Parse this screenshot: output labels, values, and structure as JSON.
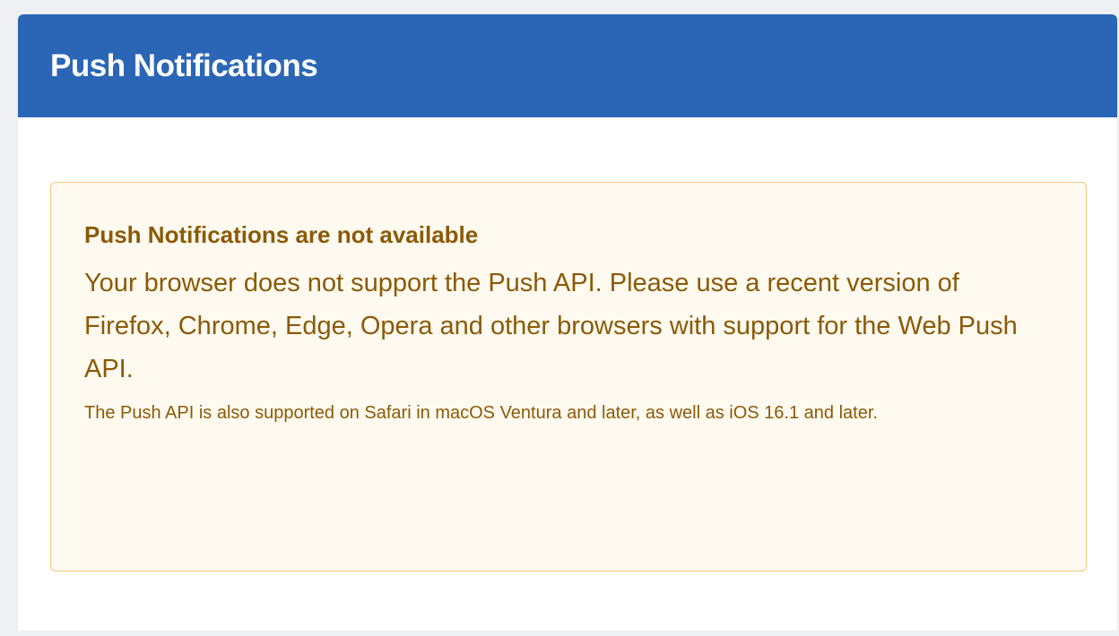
{
  "header": {
    "title": "Push Notifications"
  },
  "alert": {
    "title": "Push Notifications are not available",
    "body": "Your browser does not support the Push API. Please use a recent version of Firefox, Chrome, Edge, Opera and other browsers with support for the Web Push API.",
    "note": "The Push API is also supported on Safari in macOS Ventura and later, as well as iOS 16.1 and later."
  },
  "colors": {
    "header_background": "#2a66b5",
    "alert_background": "#fffaf0",
    "alert_border": "#f5c67a",
    "alert_text": "#8b5a06"
  }
}
